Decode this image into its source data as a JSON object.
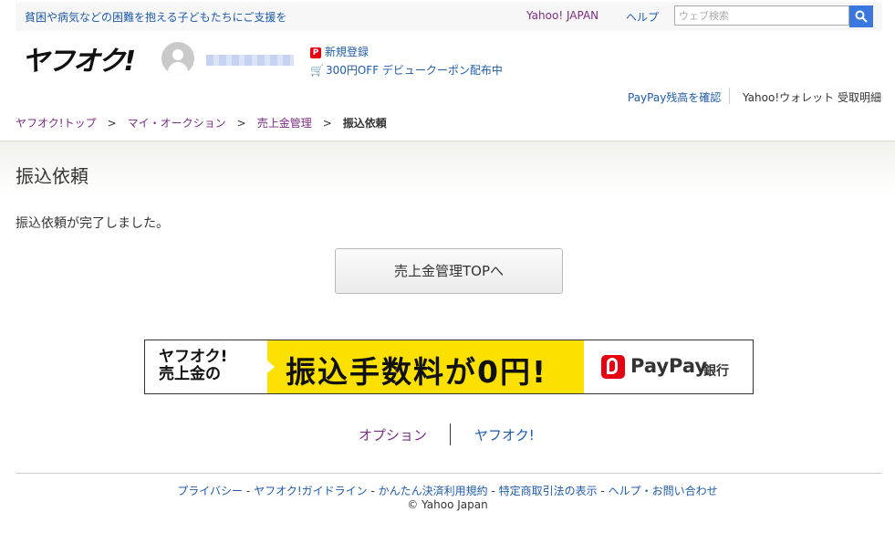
{
  "topbar": {
    "promo": "貧困や病気などの困難を抱える子どもたちにご支援を",
    "yahoo_japan": "Yahoo! JAPAN",
    "help": "ヘルプ",
    "search_placeholder": "ウェブ検索"
  },
  "header": {
    "logo": "ヤフオク!",
    "register": "新規登録",
    "register_badge": "P",
    "coupon": "300円OFF デビュークーポン配布中",
    "paypay_balance": "PayPay残高を確認",
    "wallet": "Yahoo!ウォレット 受取明細"
  },
  "breadcrumb": {
    "items": [
      "ヤフオク!トップ",
      "マイ・オークション",
      "売上金管理"
    ],
    "separator": ">",
    "current": "振込依頼"
  },
  "page": {
    "title": "振込依頼",
    "message": "振込依頼が完了しました。",
    "top_button": "売上金管理TOPへ"
  },
  "banner": {
    "left_line1": "ヤフオク!",
    "left_line2": "売上金の",
    "main": "振込手数料が0円!",
    "brand": "PayPay",
    "bank": "銀行"
  },
  "links": {
    "option": "オプション",
    "yafuoku": "ヤフオク!"
  },
  "footer": {
    "links": [
      "プライバシー",
      "ヤフオク!ガイドライン",
      "かんたん決済利用規約",
      "特定商取引法の表示",
      "ヘルプ・お問い合わせ"
    ],
    "separator": "-",
    "copyright": "© Yahoo Japan"
  },
  "colors": {
    "link_blue": "#1f5ba8",
    "link_purple": "#7b2c83",
    "search_button": "#3a78e0",
    "banner_yellow": "#fce100",
    "paypay_red": "#e60012"
  }
}
